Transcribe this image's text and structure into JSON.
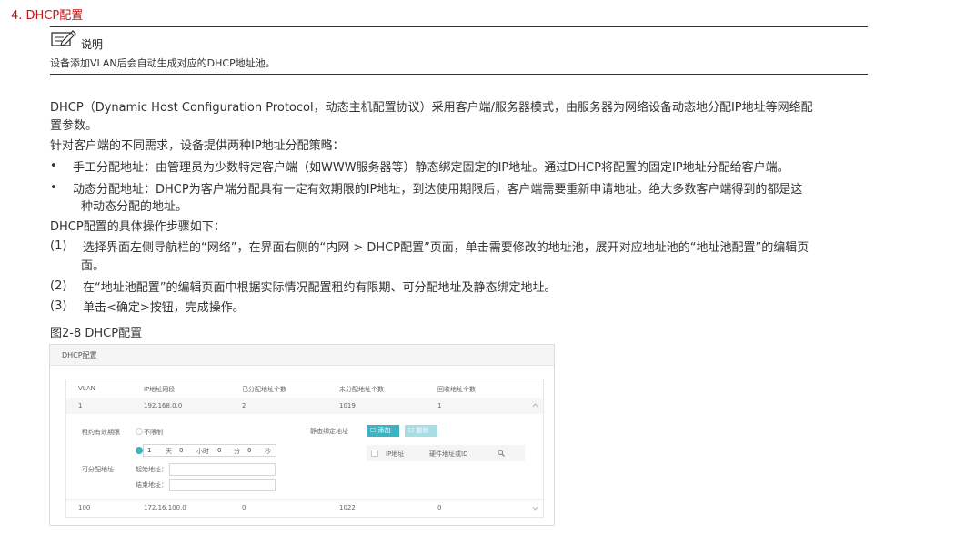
{
  "section_title": "4. DHCP配置",
  "note": {
    "label": "说明",
    "text": "设备添加VLAN后会自动生成对应的DHCP地址池。"
  },
  "intro": [
    "DHCP（Dynamic Host Configuration Protocol，动态主机配置协议）采用客户端/服务器模式，由服务器为网络设备动态地分配IP地址等网络配",
    "置参数。"
  ],
  "strategies_intro": "针对客户端的不同需求，设备提供两种IP地址分配策略：",
  "bullets": [
    {
      "lines": [
        "手工分配地址：由管理员为少数特定客户端（如WWW服务器等）静态绑定固定的IP地址。通过DHCP将配置的固定IP地址分配给客户端。"
      ]
    },
    {
      "lines": [
        "动态分配地址：DHCP为客户端分配具有一定有效期限的IP地址，到达使用期限后，客户端需要重新申请地址。绝大多数客户端得到的都是这",
        "种动态分配的地址。"
      ]
    }
  ],
  "steps_intro": "DHCP配置的具体操作步骤如下：",
  "steps": [
    {
      "num": "(1)",
      "lines": [
        "选择界面左侧导航栏的“网络”，在界面右侧的“内网 > DHCP配置”页面，单击需要修改的地址池，展开对应地址池的“地址池配置”的编辑页",
        "面。"
      ]
    },
    {
      "num": "(2)",
      "lines": [
        "在“地址池配置”的编辑页面中根据实际情况配置租约有限期、可分配地址及静态绑定地址。"
      ]
    },
    {
      "num": "(3)",
      "lines": [
        "单击<确定>按钮，完成操作。"
      ]
    }
  ],
  "figure": {
    "caption": "图2-8 DHCP配置",
    "panel_title": "DHCP配置",
    "columns": [
      "VLAN",
      "IP地址网段",
      "已分配地址个数",
      "未分配地址个数",
      "回收地址个数"
    ],
    "rows": [
      {
        "vlan": "1",
        "network": "192.168.0.0",
        "allocated": "2",
        "unallocated": "1019",
        "recycled": "1"
      },
      {
        "vlan": "100",
        "network": "172.16.100.0",
        "allocated": "0",
        "unallocated": "1022",
        "recycled": "0"
      }
    ],
    "lease_label": "租约有效期限",
    "unlimited_label": "不限制",
    "lease_days": "1",
    "day_unit": "天",
    "lease_hours": "0",
    "hour_unit": "小时",
    "lease_minutes": "0",
    "minute_unit": "分",
    "lease_seconds": "0",
    "second_unit": "秒",
    "assignable_label": "可分配地址",
    "start_label": "起始地址：",
    "end_label": "结束地址：",
    "static_label": "静态绑定地址",
    "add_button": "添加",
    "delete_button": "删除",
    "inner_columns": [
      "IP地址",
      "硬件地址或ID"
    ],
    "accent_color": "#3bb3c3"
  }
}
